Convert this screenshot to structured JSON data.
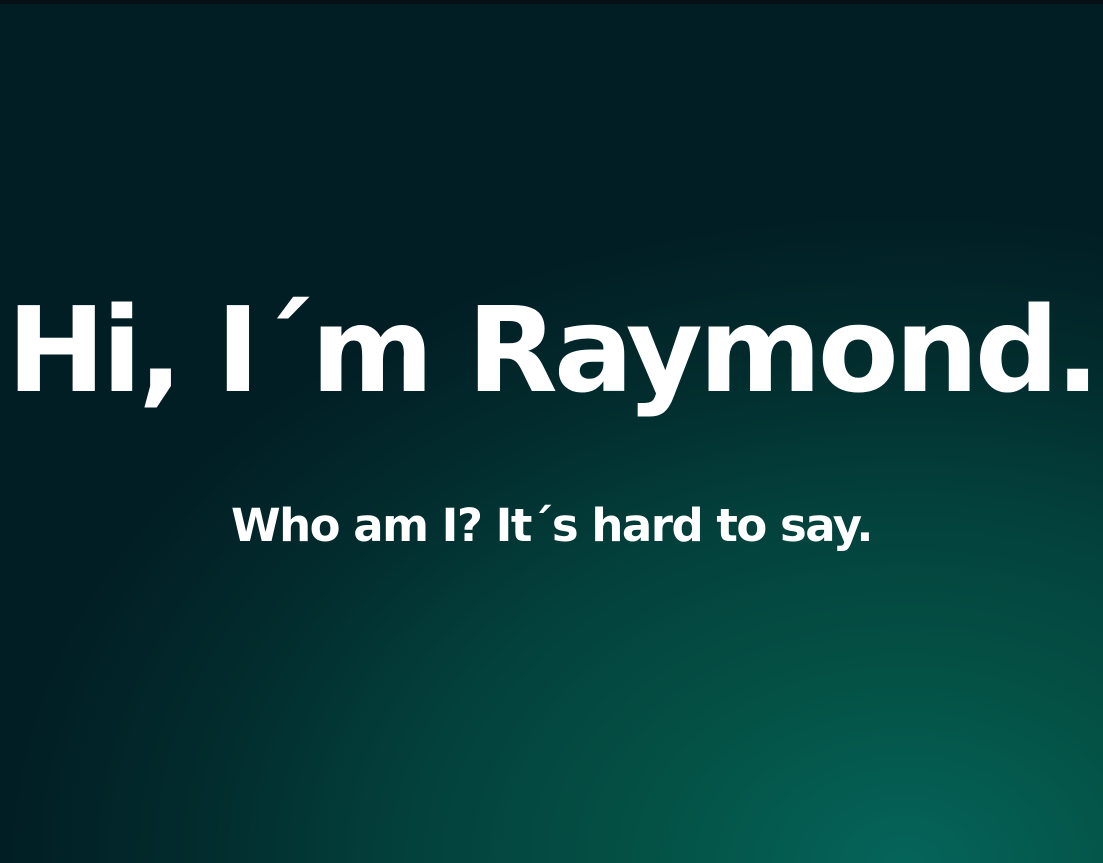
{
  "hero": {
    "title": "Hi, I´m Raymond.",
    "subtitle": "Who am I? It´s hard to say."
  },
  "colors": {
    "text": "#ffffff",
    "background_dark": "#011e24",
    "background_light": "#05645a"
  }
}
